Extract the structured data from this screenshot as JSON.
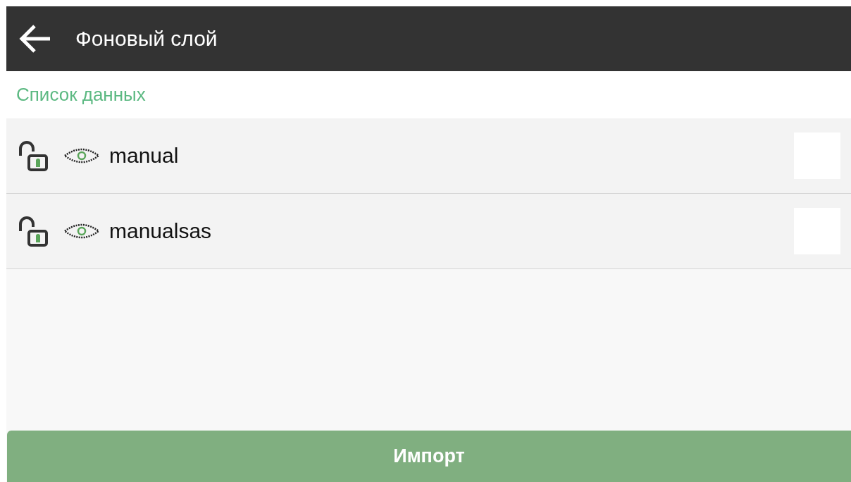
{
  "app_bar": {
    "title": "Фоновый слой"
  },
  "section_title": "Список данных",
  "layers": [
    {
      "name": "manual",
      "checked": false
    },
    {
      "name": "manualsas",
      "checked": false
    }
  ],
  "import_button": "Импорт"
}
